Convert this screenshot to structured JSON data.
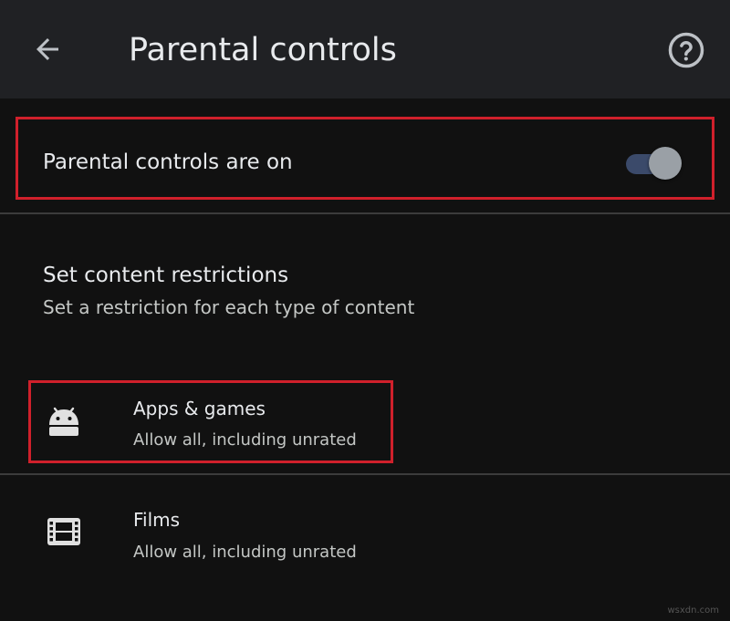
{
  "app_bar": {
    "title": "Parental controls",
    "back_icon": "arrow-left-icon",
    "help_icon": "help-circle-icon"
  },
  "master_toggle": {
    "label": "Parental controls are on",
    "state": "on"
  },
  "content_section": {
    "title": "Set content restrictions",
    "subtitle": "Set a restriction for each type of content"
  },
  "items": [
    {
      "title": "Apps & games",
      "subtitle": "Allow all, including unrated",
      "icon": "android-icon"
    },
    {
      "title": "Films",
      "subtitle": "Allow all, including unrated",
      "icon": "film-icon"
    }
  ],
  "watermark": "wsxdn.com",
  "colors": {
    "background": "#111111",
    "app_bar": "#202124",
    "highlight": "#d0202b",
    "toggle_track": "#3b4a6a",
    "toggle_thumb": "#9aa0a6"
  }
}
